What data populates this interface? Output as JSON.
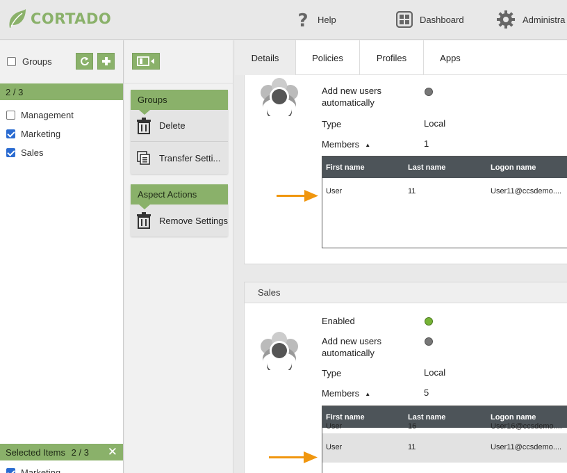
{
  "app": {
    "brand": "CORTADO",
    "brand_color": "#8ab16a"
  },
  "header": {
    "help_label": "Help",
    "dashboard_label": "Dashboard",
    "admin_label": "Administra"
  },
  "left_panel": {
    "groups_label": "Groups",
    "count_text": "2 / 3",
    "items": [
      {
        "label": "Management",
        "checked": false
      },
      {
        "label": "Marketing",
        "checked": true
      },
      {
        "label": "Sales",
        "checked": true
      }
    ],
    "selected_label": "Selected Items",
    "selected_count": "2 / 3",
    "selected_items": [
      "Marketing"
    ]
  },
  "actions": {
    "group1_title": "Groups",
    "delete_label": "Delete",
    "transfer_label": "Transfer Setti...",
    "group2_title": "Aspect Actions",
    "remove_label": "Remove Settings"
  },
  "tabs": [
    "Details",
    "Policies",
    "Profiles",
    "Apps"
  ],
  "cards": {
    "first": {
      "add_new_users_line1": "Add new users",
      "add_new_users_line2": "automatically",
      "type_label": "Type",
      "type_value": "Local",
      "members_label": "Members",
      "members_value": "1",
      "columns": [
        "First name",
        "Last name",
        "Logon name"
      ],
      "rows": [
        {
          "first": "User",
          "last": "11",
          "logon": "User11@ccsdemo...."
        }
      ]
    },
    "second": {
      "title": "Sales",
      "enabled_label": "Enabled",
      "add_new_users_line1": "Add new users",
      "add_new_users_line2": "automatically",
      "type_label": "Type",
      "type_value": "Local",
      "members_label": "Members",
      "members_value": "5",
      "columns": [
        "First name",
        "Last name",
        "Logon name"
      ],
      "rows": [
        {
          "first": "User",
          "last": "16",
          "logon": "User16@ccsdemo...."
        },
        {
          "first": "User",
          "last": "11",
          "logon": "User11@ccsdemo...."
        }
      ]
    }
  },
  "colors": {
    "accent": "#8ab16a",
    "arrow": "#f0960e",
    "table_header": "#4d5459",
    "enabled_dot": "#76b336"
  }
}
